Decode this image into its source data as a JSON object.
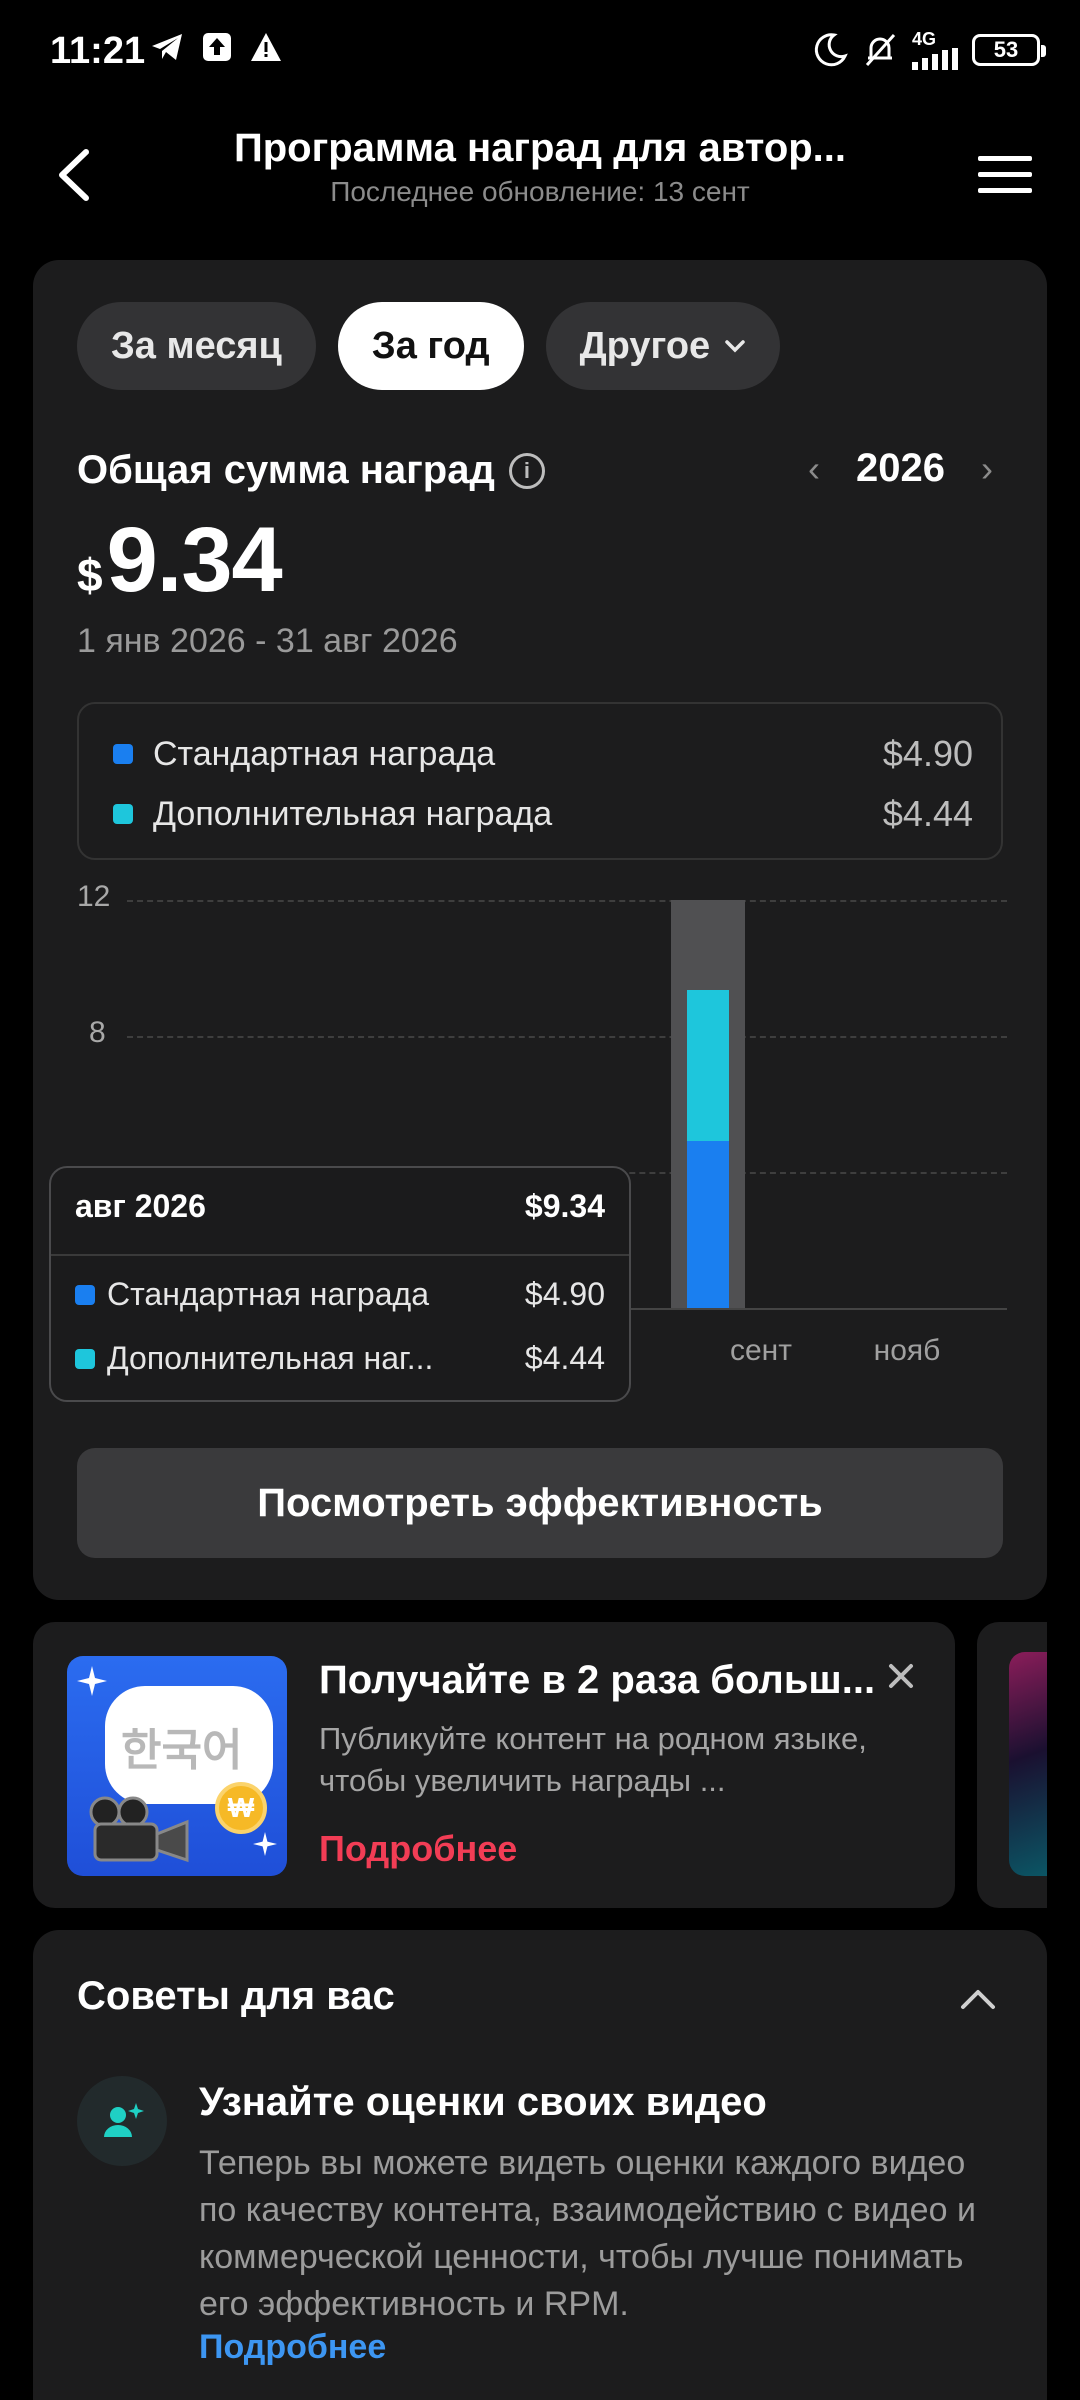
{
  "status_bar": {
    "time": "11:21",
    "network": "4G",
    "battery": "53"
  },
  "header": {
    "title": "Программа наград для автор...",
    "subtitle": "Последнее обновление: 13 сент"
  },
  "tabs": [
    {
      "label": "За месяц",
      "active": false
    },
    {
      "label": "За год",
      "active": true
    },
    {
      "label": "Другое",
      "active": false
    }
  ],
  "summary": {
    "label": "Общая сумма наград",
    "year": "2026",
    "currency": "$",
    "amount": "9.34",
    "period": "1 янв 2026 - 31 авг 2026"
  },
  "legend": [
    {
      "name": "Стандартная награда",
      "value": "$4.90",
      "color": "#1a7ff0"
    },
    {
      "name": "Дополнительная награда",
      "value": "$4.44",
      "color": "#1ec6dc"
    }
  ],
  "chart_data": {
    "type": "bar",
    "stacked": true,
    "y_ticks": [
      "12",
      "8"
    ],
    "ylim": [
      0,
      12
    ],
    "x_labels": [
      "сент",
      "нояб"
    ],
    "highlight_category": "авг 2026",
    "series": [
      {
        "name": "Стандартная награда",
        "values": [
          4.9
        ],
        "color": "#1a7ff0"
      },
      {
        "name": "Дополнительная награда",
        "values": [
          4.44
        ],
        "color": "#1ec6dc"
      }
    ],
    "grid": true
  },
  "tooltip": {
    "month": "авг 2026",
    "total": "$9.34",
    "rows": [
      {
        "name": "Стандартная награда",
        "value": "$4.90"
      },
      {
        "name": "Дополнительная наг...",
        "value": "$4.44"
      }
    ]
  },
  "performance_button": "Посмотреть эффективность",
  "promo": {
    "title": "Получайте в 2 раза больш...",
    "description": "Публикуйте контент на родном языке, чтобы увеличить награды ...",
    "more": "Подробнее",
    "image_text": "한국어",
    "coin": "₩"
  },
  "tips": {
    "title": "Советы для вас",
    "item_title": "Узнайте оценки своих видео",
    "item_body": "Теперь вы можете видеть оценки каждого видео по качеству контента, взаимодействию с видео и коммерческой ценности, чтобы лучше понимать его эффективность и RPM.",
    "item_more": "Подробнее"
  }
}
